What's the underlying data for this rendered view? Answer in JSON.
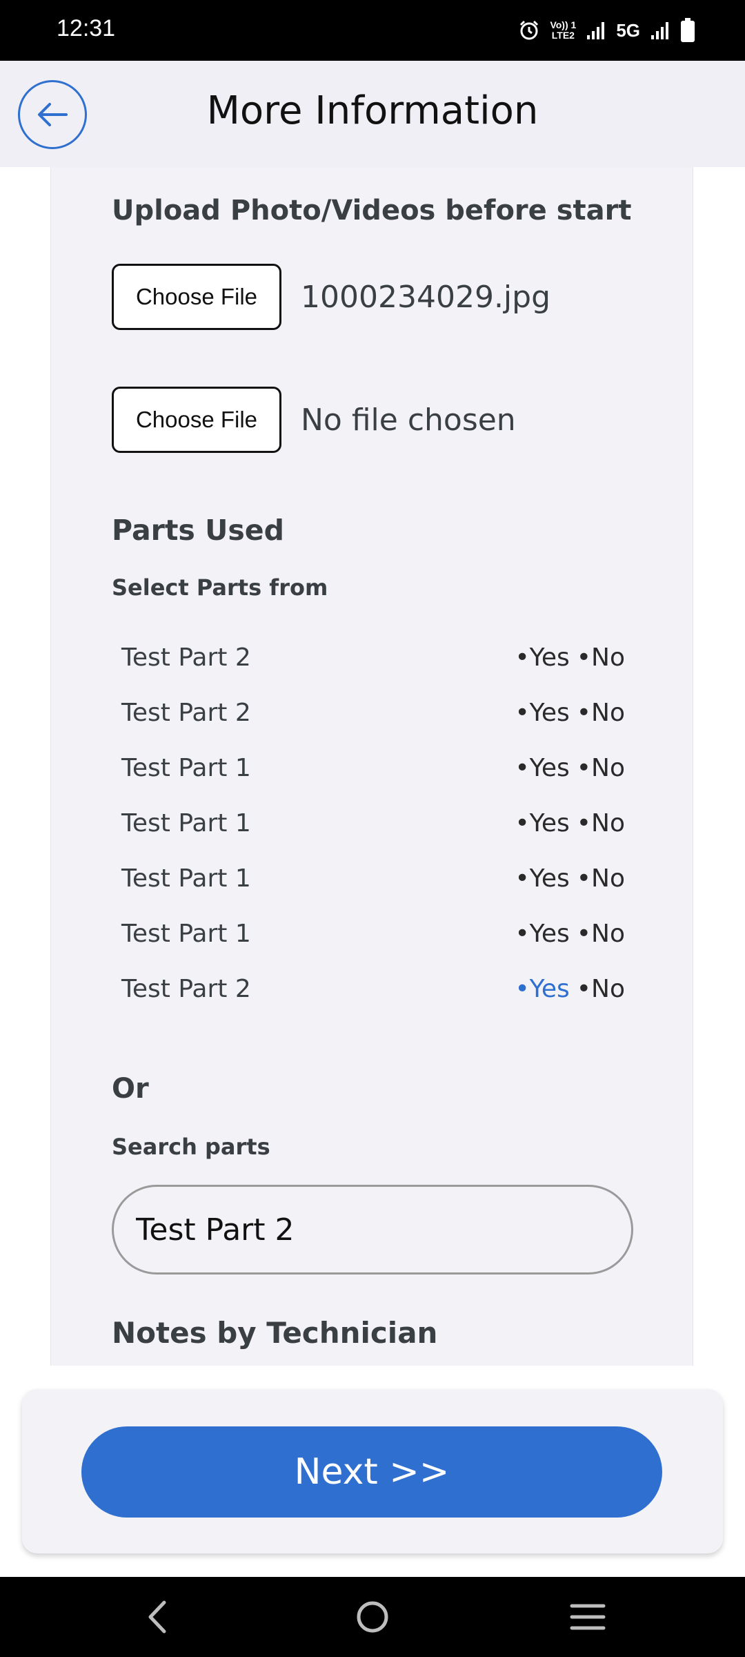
{
  "status_bar": {
    "time": "12:31",
    "volte_line1": "Vo)) 1",
    "volte_line2": "LTE2",
    "network": "5G"
  },
  "header": {
    "title": "More Information",
    "back_icon": "arrow-left-icon"
  },
  "upload": {
    "title": "Upload Photo/Videos before start",
    "files": [
      {
        "button_label": "Choose File",
        "file_name": "1000234029.jpg"
      },
      {
        "button_label": "Choose File",
        "file_name": "No file chosen"
      }
    ]
  },
  "parts": {
    "title": "Parts Used",
    "subtitle": "Select Parts from",
    "yes_label": "•Yes",
    "no_label": "•No",
    "items": [
      {
        "name": "Test Part 2",
        "selected": ""
      },
      {
        "name": "Test Part 2",
        "selected": ""
      },
      {
        "name": "Test Part 1",
        "selected": ""
      },
      {
        "name": "Test Part 1",
        "selected": ""
      },
      {
        "name": "Test Part 1",
        "selected": ""
      },
      {
        "name": "Test Part 1",
        "selected": ""
      },
      {
        "name": "Test Part 2",
        "selected": "yes"
      }
    ],
    "selected_color": "#2f6fcf"
  },
  "search": {
    "or_label": "Or",
    "label": "Search parts",
    "value": "Test Part 2"
  },
  "notes": {
    "title": "Notes by Technician"
  },
  "footer": {
    "next_label": "Next >>",
    "accent": "#2f6fcf"
  },
  "nav": {
    "back_icon": "nav-back-icon",
    "home_icon": "nav-home-icon",
    "menu_icon": "nav-menu-icon"
  }
}
